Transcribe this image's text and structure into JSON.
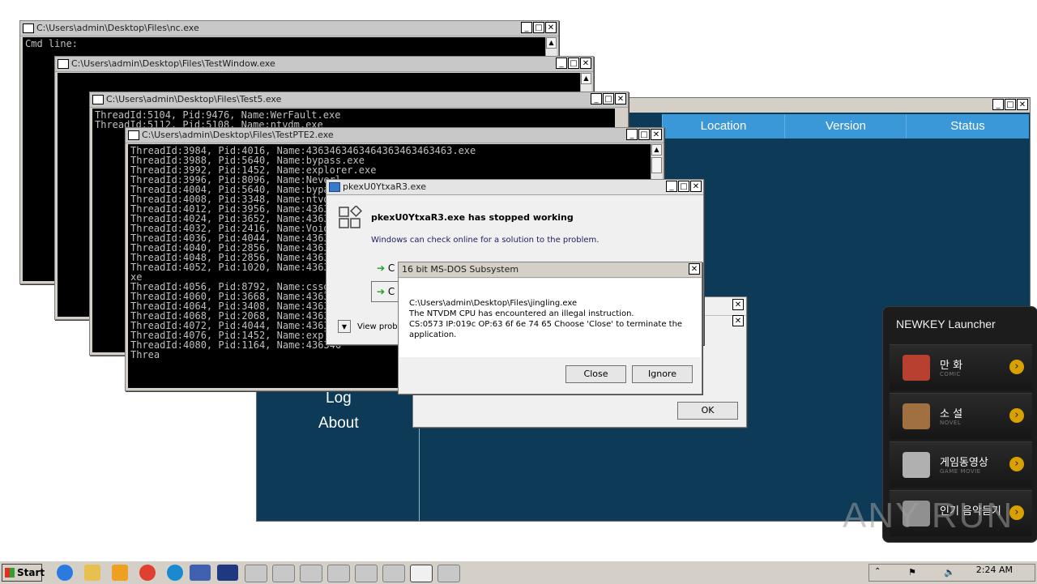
{
  "windows": {
    "nc": {
      "title": "C:\\Users\\admin\\Desktop\\Files\\nc.exe",
      "content": "Cmd line:"
    },
    "testwindow": {
      "title": "C:\\Users\\admin\\Desktop\\Files\\TestWindow.exe"
    },
    "test5": {
      "title": "C:\\Users\\admin\\Desktop\\Files\\Test5.exe",
      "lines": [
        "ThreadId:5104, Pid:9476, Name:WerFault.exe",
        "ThreadId:5112, Pid:5108, Name:ntvdm.exe"
      ]
    },
    "testpte2": {
      "title": "C:\\Users\\admin\\Desktop\\Files\\TestPTE2.exe",
      "lines": [
        "ThreadId:3984, Pid:4016, Name:4363463463464363463463463.exe",
        "ThreadId:3988, Pid:5640, Name:bypass.exe",
        "ThreadId:3992, Pid:1452, Name:explorer.exe",
        "ThreadId:3996, Pid:8096, Name:Neverl",
        "ThreadId:4004, Pid:5640, Name:bypass",
        "ThreadId:4008, Pid:3348, Name:ntvdm.",
        "ThreadId:4012, Pid:3956, Name:436346",
        "ThreadId:4024, Pid:3652, Name:436346",
        "ThreadId:4032, Pid:2416, Name:VoidRA",
        "ThreadId:4036, Pid:4044, Name:436346",
        "ThreadId:4040, Pid:2856, Name:436346",
        "ThreadId:4048, Pid:2856, Name:436346",
        "ThreadId:4052, Pid:1020, Name:436346",
        "xe",
        "ThreadId:4056, Pid:8792, Name:cssgo.",
        "ThreadId:4060, Pid:3668, Name:436346",
        "ThreadId:4064, Pid:3408, Name:436346",
        "ThreadId:4068, Pid:2068, Name:436346",
        "ThreadId:4072, Pid:4044, Name:436346",
        "ThreadId:4076, Pid:1452, Name:explor",
        "ThreadId:4080, Pid:1164, Name:436346",
        "Threa"
      ]
    }
  },
  "blue_app": {
    "columns": [
      "Location",
      "Version",
      "Status"
    ],
    "nav": [
      "Log",
      "About"
    ]
  },
  "crash_dialog": {
    "title": "pkexU0YtxaR3.exe",
    "heading": "pkexU0YtxaR3.exe has stopped working",
    "body": "Windows can check online for a solution to the problem.",
    "option1": "C",
    "option2": "C",
    "details": "View probl"
  },
  "ntvdm_dialog": {
    "title": "16 bit MS-DOS Subsystem",
    "line1": "C:\\Users\\admin\\Desktop\\Files\\jingling.exe",
    "line2": "The NTVDM CPU has encountered an illegal instruction.",
    "line3": "CS:0573 IP:019c OP:63 6f 6e 74 65 Choose 'Close' to terminate the",
    "line4": "application.",
    "close_label": "Close",
    "ignore_label": "Ignore"
  },
  "ok_dialog": {
    "ok_label": "OK"
  },
  "newkey": {
    "title": "NEWKEY Launcher",
    "items": [
      {
        "label": "만 화",
        "sub": "COMIC"
      },
      {
        "label": "소 설",
        "sub": "NOVEL"
      },
      {
        "label": "게임동영상",
        "sub": "GAME MOVIE"
      },
      {
        "label": "인기 음악듣기",
        "sub": ""
      }
    ]
  },
  "watermark": "ANY RUN",
  "taskbar": {
    "start_label": "Start",
    "clock": "2:24 AM"
  }
}
